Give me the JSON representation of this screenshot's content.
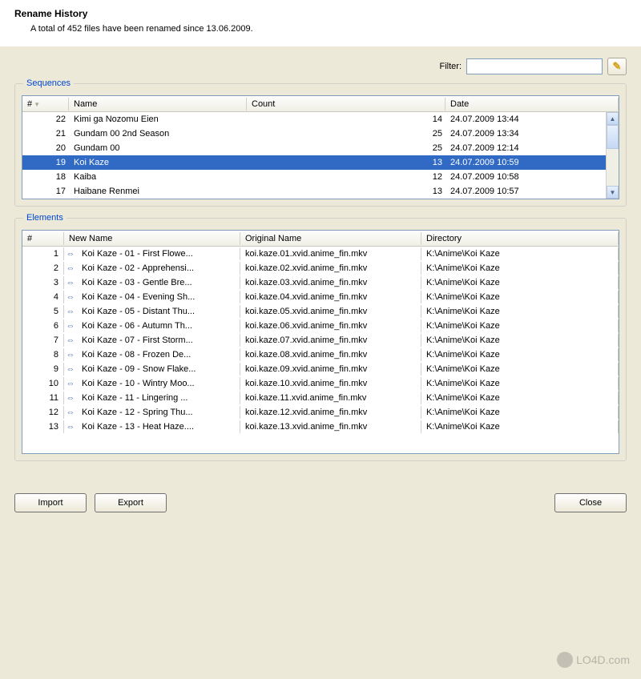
{
  "header": {
    "title": "Rename History",
    "subtitle": "A total of 452 files have been renamed since 13.06.2009."
  },
  "filter": {
    "label": "Filter:",
    "value": "",
    "placeholder": ""
  },
  "sequences": {
    "legend": "Sequences",
    "columns": {
      "num": "#",
      "name": "Name",
      "count": "Count",
      "date": "Date"
    },
    "rows": [
      {
        "num": "22",
        "name": "Kimi ga Nozomu Eien",
        "count": "14",
        "date": "24.07.2009 13:44",
        "selected": false
      },
      {
        "num": "21",
        "name": "Gundam 00 2nd Season",
        "count": "25",
        "date": "24.07.2009 13:34",
        "selected": false
      },
      {
        "num": "20",
        "name": "Gundam 00",
        "count": "25",
        "date": "24.07.2009 12:14",
        "selected": false
      },
      {
        "num": "19",
        "name": "Koi Kaze",
        "count": "13",
        "date": "24.07.2009 10:59",
        "selected": true
      },
      {
        "num": "18",
        "name": "Kaiba",
        "count": "12",
        "date": "24.07.2009 10:58",
        "selected": false
      },
      {
        "num": "17",
        "name": "Haibane Renmei",
        "count": "13",
        "date": "24.07.2009 10:57",
        "selected": false
      }
    ]
  },
  "elements": {
    "legend": "Elements",
    "columns": {
      "num": "#",
      "new": "New Name",
      "orig": "Original Name",
      "dir": "Directory"
    },
    "rows": [
      {
        "num": "1",
        "new": "Koi Kaze - 01 - First Flowe...",
        "orig": "koi.kaze.01.xvid.anime_fin.mkv",
        "dir": "K:\\Anime\\Koi Kaze"
      },
      {
        "num": "2",
        "new": "Koi Kaze - 02 - Apprehensi...",
        "orig": "koi.kaze.02.xvid.anime_fin.mkv",
        "dir": "K:\\Anime\\Koi Kaze"
      },
      {
        "num": "3",
        "new": "Koi Kaze - 03 - Gentle Bre...",
        "orig": "koi.kaze.03.xvid.anime_fin.mkv",
        "dir": "K:\\Anime\\Koi Kaze"
      },
      {
        "num": "4",
        "new": "Koi Kaze - 04 - Evening Sh...",
        "orig": "koi.kaze.04.xvid.anime_fin.mkv",
        "dir": "K:\\Anime\\Koi Kaze"
      },
      {
        "num": "5",
        "new": "Koi Kaze - 05 - Distant Thu...",
        "orig": "koi.kaze.05.xvid.anime_fin.mkv",
        "dir": "K:\\Anime\\Koi Kaze"
      },
      {
        "num": "6",
        "new": "Koi Kaze - 06 - Autumn Th...",
        "orig": "koi.kaze.06.xvid.anime_fin.mkv",
        "dir": "K:\\Anime\\Koi Kaze"
      },
      {
        "num": "7",
        "new": "Koi Kaze - 07 - First Storm...",
        "orig": "koi.kaze.07.xvid.anime_fin.mkv",
        "dir": "K:\\Anime\\Koi Kaze"
      },
      {
        "num": "8",
        "new": "Koi Kaze - 08 - Frozen De...",
        "orig": "koi.kaze.08.xvid.anime_fin.mkv",
        "dir": "K:\\Anime\\Koi Kaze"
      },
      {
        "num": "9",
        "new": "Koi Kaze - 09 - Snow Flake...",
        "orig": "koi.kaze.09.xvid.anime_fin.mkv",
        "dir": "K:\\Anime\\Koi Kaze"
      },
      {
        "num": "10",
        "new": "Koi Kaze - 10 - Wintry Moo...",
        "orig": "koi.kaze.10.xvid.anime_fin.mkv",
        "dir": "K:\\Anime\\Koi Kaze"
      },
      {
        "num": "11",
        "new": "Koi Kaze - 11 - Lingering ...",
        "orig": "koi.kaze.11.xvid.anime_fin.mkv",
        "dir": "K:\\Anime\\Koi Kaze"
      },
      {
        "num": "12",
        "new": "Koi Kaze - 12 - Spring Thu...",
        "orig": "koi.kaze.12.xvid.anime_fin.mkv",
        "dir": "K:\\Anime\\Koi Kaze"
      },
      {
        "num": "13",
        "new": "Koi Kaze - 13 - Heat Haze....",
        "orig": "koi.kaze.13.xvid.anime_fin.mkv",
        "dir": "K:\\Anime\\Koi Kaze"
      }
    ]
  },
  "buttons": {
    "import": "Import",
    "export": "Export",
    "close": "Close"
  },
  "watermark": "LO4D.com"
}
